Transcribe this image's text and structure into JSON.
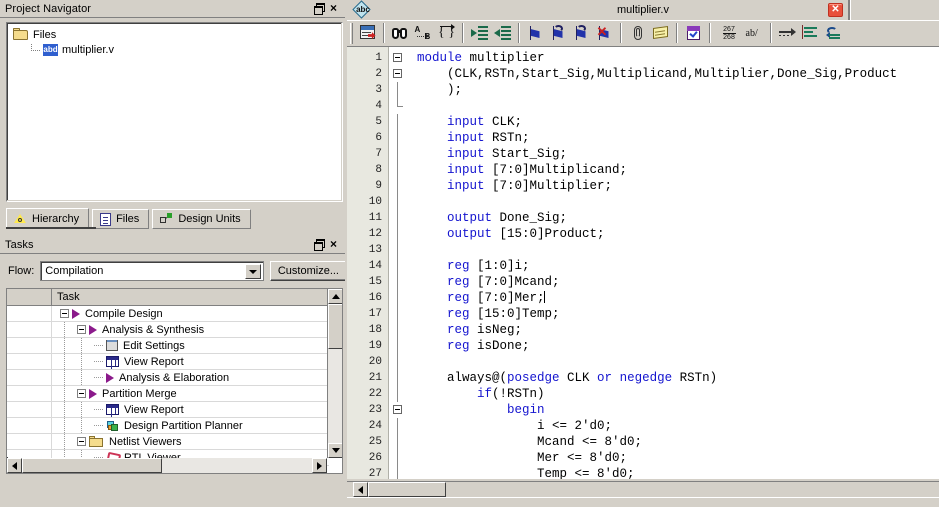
{
  "project_navigator": {
    "title": "Project Navigator",
    "restore_icon": "restore-icon",
    "close_icon": "close-icon",
    "close_glyph": "×",
    "tree": [
      {
        "label": "Files",
        "icon": "folder-icon",
        "indent": 0
      },
      {
        "label": "multiplier.v",
        "icon": "verilog-file-icon",
        "icon_text": "abd",
        "indent": 1
      }
    ],
    "tabs": [
      {
        "label": "Hierarchy",
        "icon": "hierarchy-icon",
        "active": true
      },
      {
        "label": "Files",
        "icon": "files-icon",
        "active": false
      },
      {
        "label": "Design Units",
        "icon": "design-units-icon",
        "active": false
      }
    ]
  },
  "tasks_panel": {
    "title": "Tasks",
    "restore_icon": "restore-icon",
    "close_icon": "close-icon",
    "close_glyph": "×",
    "flow_label": "Flow:",
    "flow_value": "Compilation",
    "customize_button": "Customize...",
    "column_headers": [
      "",
      "Task"
    ],
    "rows": [
      {
        "label": "Compile Design",
        "indent": 0,
        "expander": true,
        "icon": "play-triangle-icon"
      },
      {
        "label": "Analysis & Synthesis",
        "indent": 1,
        "expander": true,
        "icon": "play-triangle-icon"
      },
      {
        "label": "Edit Settings",
        "indent": 2,
        "expander": false,
        "icon": "settings-icon"
      },
      {
        "label": "View Report",
        "indent": 2,
        "expander": false,
        "icon": "report-icon"
      },
      {
        "label": "Analysis & Elaboration",
        "indent": 2,
        "expander": false,
        "icon": "play-triangle-icon"
      },
      {
        "label": "Partition Merge",
        "indent": 1,
        "expander": true,
        "icon": "play-triangle-icon"
      },
      {
        "label": "View Report",
        "indent": 2,
        "expander": false,
        "icon": "report-icon"
      },
      {
        "label": "Design Partition Planner",
        "indent": 2,
        "expander": false,
        "icon": "partition-planner-icon"
      },
      {
        "label": "Netlist Viewers",
        "indent": 1,
        "expander": true,
        "icon": "folder-icon"
      },
      {
        "label": "RTL Viewer",
        "indent": 2,
        "expander": false,
        "icon": "rtl-viewer-icon"
      }
    ]
  },
  "editor": {
    "title": "multiplier.v",
    "spell_icon": "spell-check-icon",
    "spell_icon_text": "abc",
    "close_glyph": "✕",
    "toolbar": [
      {
        "name": "goto-line-icon",
        "group": 0
      },
      {
        "name": "find-icon",
        "group": 1
      },
      {
        "name": "find-next-icon",
        "group": 1
      },
      {
        "name": "match-brace-icon",
        "group": 1
      },
      {
        "name": "increase-indent-icon",
        "group": 2
      },
      {
        "name": "decrease-indent-icon",
        "group": 2
      },
      {
        "name": "toggle-bookmark-icon",
        "group": 3
      },
      {
        "name": "next-bookmark-icon",
        "group": 3
      },
      {
        "name": "previous-bookmark-icon",
        "group": 3
      },
      {
        "name": "clear-bookmarks-icon",
        "group": 3
      },
      {
        "name": "insert-template-icon",
        "group": 4
      },
      {
        "name": "insert-comment-icon",
        "group": 4
      },
      {
        "name": "check-syntax-icon",
        "group": 5
      },
      {
        "name": "line-numbers-icon",
        "group": 6,
        "label_top": "267",
        "label_bottom": "268"
      },
      {
        "name": "text-wrap-icon",
        "group": 6,
        "label": "ab/"
      },
      {
        "name": "go-forward-icon",
        "group": 7
      },
      {
        "name": "indent-block-icon",
        "group": 7
      },
      {
        "name": "undo-indent-icon",
        "group": 7
      }
    ],
    "line_numbers": [
      1,
      2,
      3,
      4,
      5,
      6,
      7,
      8,
      9,
      10,
      11,
      12,
      13,
      14,
      15,
      16,
      17,
      18,
      19,
      20,
      21,
      22,
      23,
      24,
      25,
      26,
      27
    ],
    "code_lines": [
      {
        "n": 1,
        "fold": "box",
        "tokens": [
          {
            "t": "module",
            "k": true
          },
          {
            "t": " multiplier",
            "k": false
          }
        ]
      },
      {
        "n": 2,
        "fold": "box",
        "tokens": [
          {
            "t": "    (CLK,RSTn,Start_Sig,Multiplicand,Multiplier,Done_Sig,Product",
            "k": false
          }
        ]
      },
      {
        "n": 3,
        "fold": "line",
        "tokens": [
          {
            "t": "    );",
            "k": false
          }
        ]
      },
      {
        "n": 4,
        "fold": "end",
        "tokens": [
          {
            "t": "",
            "k": false
          }
        ]
      },
      {
        "n": 5,
        "fold": "line",
        "tokens": [
          {
            "t": "    ",
            "k": false
          },
          {
            "t": "input",
            "k": true
          },
          {
            "t": " CLK;",
            "k": false
          }
        ]
      },
      {
        "n": 6,
        "fold": "line",
        "tokens": [
          {
            "t": "    ",
            "k": false
          },
          {
            "t": "input",
            "k": true
          },
          {
            "t": " RSTn;",
            "k": false
          }
        ]
      },
      {
        "n": 7,
        "fold": "line",
        "tokens": [
          {
            "t": "    ",
            "k": false
          },
          {
            "t": "input",
            "k": true
          },
          {
            "t": " Start_Sig;",
            "k": false
          }
        ]
      },
      {
        "n": 8,
        "fold": "line",
        "tokens": [
          {
            "t": "    ",
            "k": false
          },
          {
            "t": "input",
            "k": true
          },
          {
            "t": " [7:0]Multiplicand;",
            "k": false
          }
        ]
      },
      {
        "n": 9,
        "fold": "line",
        "tokens": [
          {
            "t": "    ",
            "k": false
          },
          {
            "t": "input",
            "k": true
          },
          {
            "t": " [7:0]Multiplier;",
            "k": false
          }
        ]
      },
      {
        "n": 10,
        "fold": "line",
        "tokens": [
          {
            "t": "",
            "k": false
          }
        ]
      },
      {
        "n": 11,
        "fold": "line",
        "tokens": [
          {
            "t": "    ",
            "k": false
          },
          {
            "t": "output",
            "k": true
          },
          {
            "t": " Done_Sig;",
            "k": false
          }
        ]
      },
      {
        "n": 12,
        "fold": "line",
        "tokens": [
          {
            "t": "    ",
            "k": false
          },
          {
            "t": "output",
            "k": true
          },
          {
            "t": " [15:0]Product;",
            "k": false
          }
        ]
      },
      {
        "n": 13,
        "fold": "line",
        "tokens": [
          {
            "t": "",
            "k": false
          }
        ]
      },
      {
        "n": 14,
        "fold": "line",
        "tokens": [
          {
            "t": "    ",
            "k": false
          },
          {
            "t": "reg",
            "k": true
          },
          {
            "t": " [1:0]i;",
            "k": false
          }
        ]
      },
      {
        "n": 15,
        "fold": "line",
        "tokens": [
          {
            "t": "    ",
            "k": false
          },
          {
            "t": "reg",
            "k": true
          },
          {
            "t": " [7:0]Mcand;",
            "k": false
          }
        ]
      },
      {
        "n": 16,
        "fold": "line",
        "tokens": [
          {
            "t": "    ",
            "k": false
          },
          {
            "t": "reg",
            "k": true
          },
          {
            "t": " [7:0]Mer;",
            "k": false,
            "caret": true
          }
        ]
      },
      {
        "n": 17,
        "fold": "line",
        "tokens": [
          {
            "t": "    ",
            "k": false
          },
          {
            "t": "reg",
            "k": true
          },
          {
            "t": " [15:0]Temp;",
            "k": false
          }
        ]
      },
      {
        "n": 18,
        "fold": "line",
        "tokens": [
          {
            "t": "    ",
            "k": false
          },
          {
            "t": "reg",
            "k": true
          },
          {
            "t": " isNeg;",
            "k": false
          }
        ]
      },
      {
        "n": 19,
        "fold": "line",
        "tokens": [
          {
            "t": "    ",
            "k": false
          },
          {
            "t": "reg",
            "k": true
          },
          {
            "t": " isDone;",
            "k": false
          }
        ]
      },
      {
        "n": 20,
        "fold": "line",
        "tokens": [
          {
            "t": "",
            "k": false
          }
        ]
      },
      {
        "n": 21,
        "fold": "line",
        "tokens": [
          {
            "t": "    always@(",
            "k": false
          },
          {
            "t": "posedge",
            "k": true
          },
          {
            "t": " CLK ",
            "k": false
          },
          {
            "t": "or",
            "k": true
          },
          {
            "t": " ",
            "k": false
          },
          {
            "t": "negedge",
            "k": true
          },
          {
            "t": " RSTn)",
            "k": false
          }
        ]
      },
      {
        "n": 22,
        "fold": "line",
        "tokens": [
          {
            "t": "        ",
            "k": false
          },
          {
            "t": "if",
            "k": true
          },
          {
            "t": "(!RSTn)",
            "k": false
          }
        ]
      },
      {
        "n": 23,
        "fold": "box",
        "tokens": [
          {
            "t": "            ",
            "k": false
          },
          {
            "t": "begin",
            "k": true
          }
        ]
      },
      {
        "n": 24,
        "fold": "line",
        "tokens": [
          {
            "t": "                i <= 2'd0;",
            "k": false
          }
        ]
      },
      {
        "n": 25,
        "fold": "line",
        "tokens": [
          {
            "t": "                Mcand <= 8'd0;",
            "k": false
          }
        ]
      },
      {
        "n": 26,
        "fold": "line",
        "tokens": [
          {
            "t": "                Mer <= 8'd0;",
            "k": false
          }
        ]
      },
      {
        "n": 27,
        "fold": "line",
        "tokens": [
          {
            "t": "                Temp <= 8'd0;",
            "k": false
          }
        ]
      }
    ]
  },
  "colors": {
    "chrome": "#d4d0c8",
    "keyword": "#1414cf",
    "tree_triangle": "#8b1a8b",
    "close_button": "#e8503c",
    "gutter": "#e8e8e0"
  }
}
